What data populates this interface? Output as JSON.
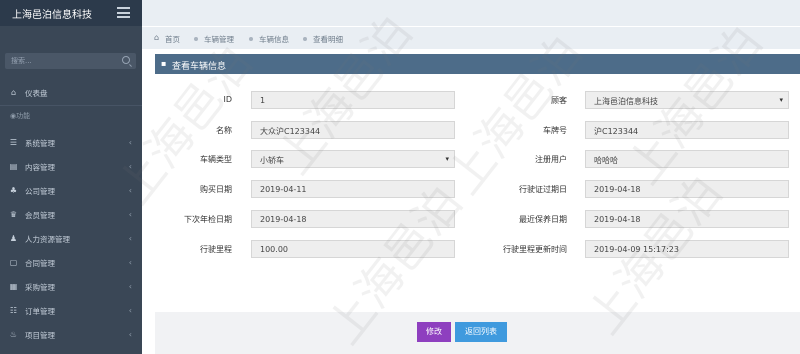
{
  "header": {
    "brand": "上海邑泊信息科技"
  },
  "sidebar": {
    "search_placeholder": "搜索...",
    "items": [
      {
        "icon": "⌂",
        "label": "仪表盘",
        "arrow": ""
      },
      {
        "icon": "☰",
        "label": "系统管理",
        "arrow": "‹"
      },
      {
        "icon": "▤",
        "label": "内容管理",
        "arrow": "‹"
      },
      {
        "icon": "♣",
        "label": "公司管理",
        "arrow": "‹"
      },
      {
        "icon": "♛",
        "label": "会员管理",
        "arrow": "‹"
      },
      {
        "icon": "♟",
        "label": "人力资源管理",
        "arrow": "‹"
      },
      {
        "icon": "▢",
        "label": "合同管理",
        "arrow": "‹"
      },
      {
        "icon": "▦",
        "label": "采购管理",
        "arrow": "‹"
      },
      {
        "icon": "☷",
        "label": "订单管理",
        "arrow": "‹"
      },
      {
        "icon": "♨",
        "label": "项目管理",
        "arrow": "‹"
      }
    ],
    "section_label": "◉功能"
  },
  "breadcrumb": {
    "home_icon": "⌂",
    "items": [
      "首页",
      "车辆管理",
      "车辆信息",
      "查看明细"
    ]
  },
  "panel": {
    "icon": "▪",
    "title": "查看车辆信息"
  },
  "form": {
    "left": [
      {
        "label": "ID",
        "value": "1"
      },
      {
        "label": "名称",
        "value": "大众沪C123344"
      },
      {
        "label": "车辆类型",
        "value": "小轿车"
      },
      {
        "label": "购买日期",
        "value": "2019-04-11"
      },
      {
        "label": "下次年检日期",
        "value": "2019-04-18"
      },
      {
        "label": "行驶里程",
        "value": "100.00"
      }
    ],
    "right": [
      {
        "label": "顾客",
        "value": "上海邑泊信息科技"
      },
      {
        "label": "车牌号",
        "value": "沪C123344"
      },
      {
        "label": "注册用户",
        "value": "哈哈哈"
      },
      {
        "label": "行驶证过期日",
        "value": "2019-04-18"
      },
      {
        "label": "最近保养日期",
        "value": "2019-04-18"
      },
      {
        "label": "行驶里程更新时间",
        "value": "2019-04-09 15:17:23"
      }
    ],
    "select_caret": "▾"
  },
  "buttons": {
    "edit": "修改",
    "back": "返回列表"
  },
  "watermark": "上海邑泊",
  "colors": {
    "topbar": "#2c3a4b",
    "sidebar": "#3a4756",
    "panel_header": "#4d6c89",
    "edit": "#8e3fbf",
    "back": "#3f9ade"
  }
}
